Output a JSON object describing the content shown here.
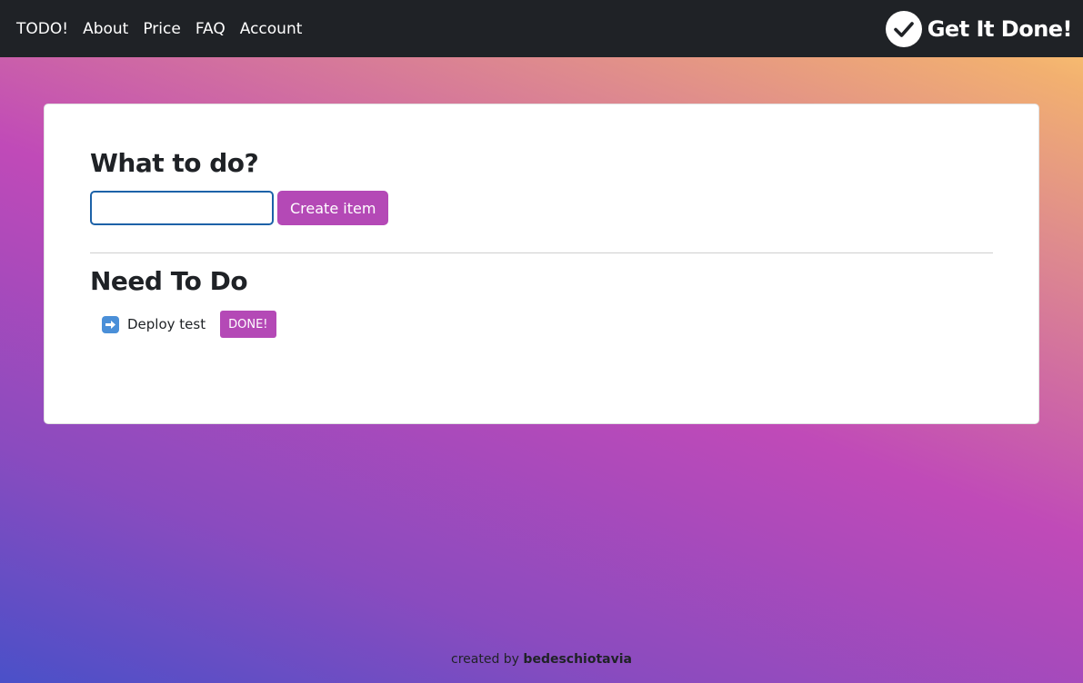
{
  "nav": {
    "links": [
      "TODO!",
      "About",
      "Price",
      "FAQ",
      "Account"
    ],
    "brand": "Get It Done!",
    "brand_icon": "check-circle-icon"
  },
  "form": {
    "title": "What to do?",
    "input_value": "",
    "input_placeholder": "",
    "create_label": "Create item"
  },
  "todo": {
    "title": "Need To Do",
    "items": [
      {
        "icon": "arrow-right-icon",
        "text": "Deploy test",
        "done_label": "DONE!"
      }
    ]
  },
  "footer": {
    "prefix": "created by",
    "author": "bedeschiotavia"
  },
  "colors": {
    "navbar": "#1f2226",
    "accent": "#b449b6",
    "input_border": "#1d62a8"
  }
}
